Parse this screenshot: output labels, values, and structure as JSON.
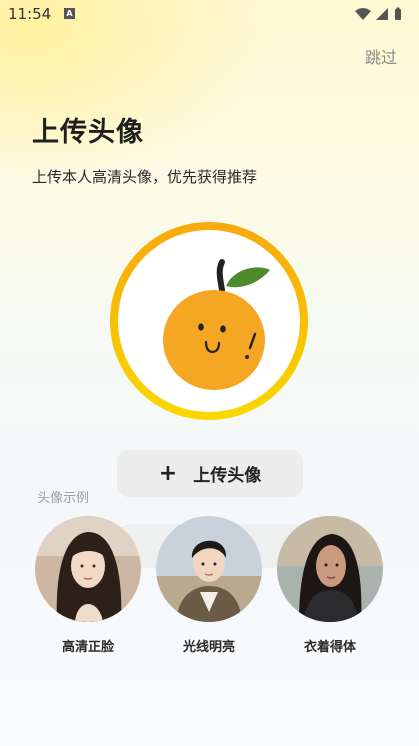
{
  "status_bar": {
    "time": "11:54",
    "app_icon_letter": "A"
  },
  "header": {
    "skip_label": "跳过"
  },
  "main": {
    "title": "上传头像",
    "subtitle": "上传本人高清头像，优先获得推荐",
    "upload_button_label": "上传头像",
    "upload_button_plus": "+"
  },
  "examples": {
    "label": "头像示例",
    "items": [
      {
        "caption": "高清正脸"
      },
      {
        "caption": "光线明亮"
      },
      {
        "caption": "衣着得体"
      }
    ]
  },
  "colors": {
    "ring_top": "#f7a90d",
    "ring_bottom": "#fbd800",
    "orange": "#f5a623",
    "leaf": "#4f8a2c"
  }
}
